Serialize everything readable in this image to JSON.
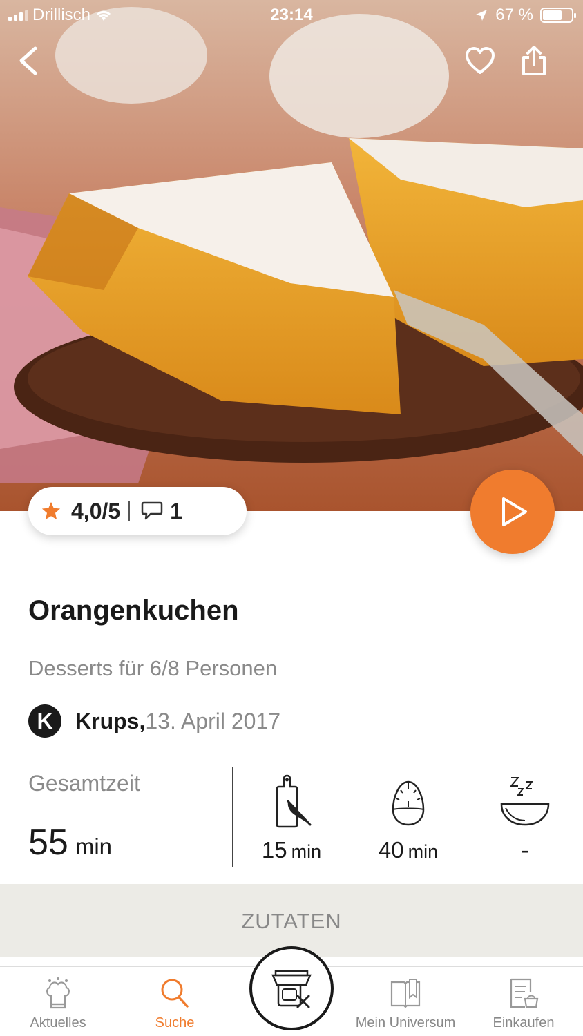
{
  "status_bar": {
    "carrier": "Drillisch",
    "time": "23:14",
    "battery": "67 %",
    "battery_level": 0.67
  },
  "header": {
    "back_icon": "chevron-left-icon",
    "favorite_icon": "heart-icon",
    "share_icon": "share-icon"
  },
  "rating": {
    "score": "4,0/5",
    "comments": "1",
    "star_color": "#f07c2e"
  },
  "play_button": {
    "icon": "play-icon",
    "color": "#f07c2e"
  },
  "recipe": {
    "title": "Orangenkuchen",
    "subtitle": "Desserts für 6/8 Personen",
    "author_logo": "K",
    "author": "Krups,",
    "date": "13. April 2017"
  },
  "times": {
    "total_label": "Gesamtzeit",
    "total_value": "55",
    "total_unit": "min",
    "prep": {
      "icon": "cutting-board-icon",
      "value": "15",
      "unit": "min"
    },
    "bake": {
      "icon": "egg-timer-icon",
      "value": "40",
      "unit": "min"
    },
    "rest": {
      "icon": "resting-bowl-icon",
      "value": "-"
    }
  },
  "section": {
    "label": "ZUTATEN"
  },
  "tabbar": {
    "tabs": [
      {
        "label": "Aktuelles",
        "icon": "chef-hat-icon",
        "active": false
      },
      {
        "label": "Suche",
        "icon": "search-icon",
        "active": true
      },
      {
        "label": "",
        "icon": "cooking-device-icon",
        "active": false
      },
      {
        "label": "Mein Universum",
        "icon": "book-icon",
        "active": false
      },
      {
        "label": "Einkaufen",
        "icon": "shopping-list-icon",
        "active": false
      }
    ],
    "active_color": "#f07c2e"
  }
}
